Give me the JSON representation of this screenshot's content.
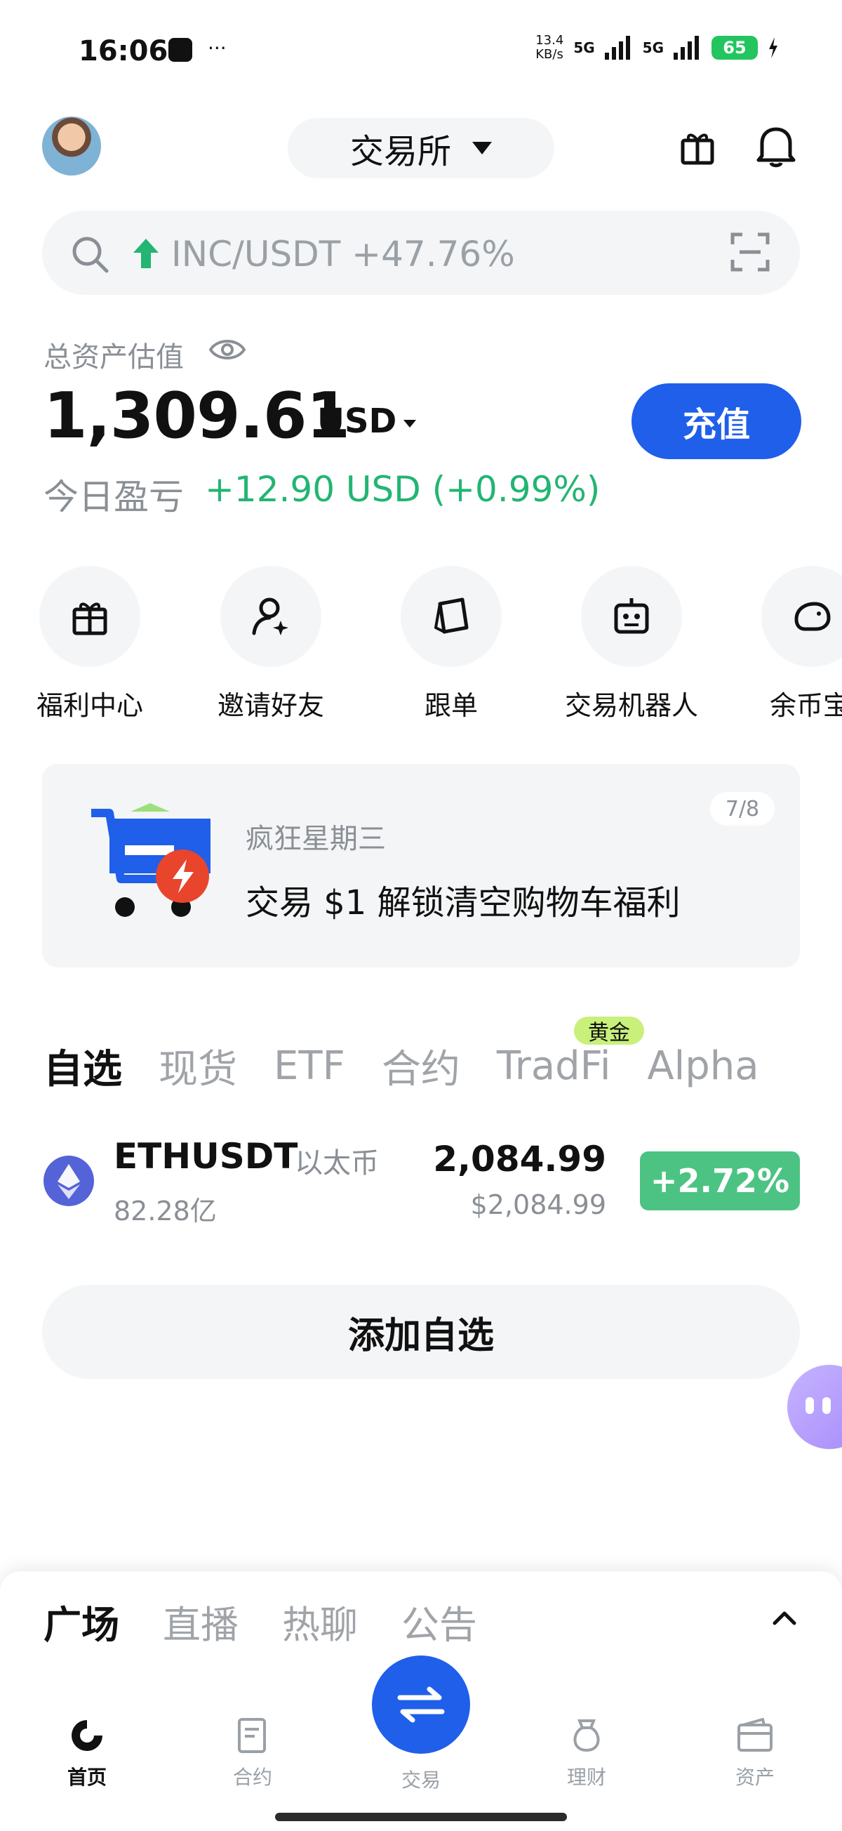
{
  "status_bar": {
    "time": "16:06",
    "dots": "···",
    "net_speed_value": "13.4",
    "net_speed_unit": "KB/s",
    "signal1": "5G",
    "signal2": "5G",
    "battery": "65"
  },
  "header": {
    "exchange_label": "交易所"
  },
  "search": {
    "placeholder": "INC/USDT +47.76%"
  },
  "assets": {
    "label": "总资产估值",
    "value": "1,309.61",
    "currency": "USD",
    "deposit_label": "充值",
    "pnl_label": "今日盈亏",
    "pnl_value": "+12.90 USD (+0.99%)",
    "pnl_color": "#22b573"
  },
  "quick_actions": [
    {
      "label": "福利中心",
      "icon": "gift-icon"
    },
    {
      "label": "邀请好友",
      "icon": "invite-user-icon"
    },
    {
      "label": "跟单",
      "icon": "copy-trade-icon"
    },
    {
      "label": "交易机器人",
      "icon": "robot-icon"
    },
    {
      "label": "余币宝",
      "icon": "piggy-bank-icon"
    }
  ],
  "banner": {
    "subtitle": "疯狂星期三",
    "title": "交易 $1 解锁清空购物车福利",
    "page": "7/8"
  },
  "market_tabs": {
    "items": [
      "自选",
      "现货",
      "ETF",
      "合约",
      "TradFi",
      "Alpha"
    ],
    "active": "自选",
    "badge": "黄金"
  },
  "watchlist": [
    {
      "symbol": "ETHUSDT",
      "name": "以太币",
      "volume": "82.28亿",
      "price": "2,084.99",
      "price_usd": "$2,084.99",
      "change": "+2.72%",
      "change_color": "#4cc382"
    }
  ],
  "add_watchlist_label": "添加自选",
  "sheet_tabs": {
    "items": [
      "广场",
      "直播",
      "热聊",
      "公告"
    ],
    "active": "广场"
  },
  "bottom_nav": [
    {
      "label": "首页",
      "icon": "home-icon",
      "active": true
    },
    {
      "label": "合约",
      "icon": "contract-icon",
      "active": false
    },
    {
      "label": "交易",
      "icon": "swap-icon",
      "active": false
    },
    {
      "label": "理财",
      "icon": "finance-icon",
      "active": false
    },
    {
      "label": "资产",
      "icon": "wallet-icon",
      "active": false
    }
  ],
  "colors": {
    "accent": "#1f5fea",
    "up_green": "#4cc382"
  }
}
